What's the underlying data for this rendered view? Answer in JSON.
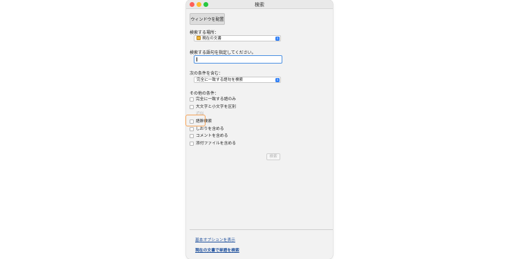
{
  "window": {
    "title": "検索"
  },
  "toolbar": {
    "arrange_label": "ウィンドウを配置"
  },
  "location": {
    "label": "検索する場所：",
    "value": "現在の文書"
  },
  "query": {
    "label": "検索する語句を指定してください。",
    "value": ""
  },
  "condition": {
    "label": "次の条件を含む：",
    "value": "完全に一致する語句を検索"
  },
  "options": {
    "label": "その他の条件：",
    "items": [
      {
        "label": "完全に一致する語のみ",
        "checked": false,
        "enabled": true
      },
      {
        "label": "大文字と小文字を区別",
        "checked": false,
        "enabled": true
      },
      {
        "label": "近似",
        "checked": false,
        "enabled": false
      },
      {
        "label": "語幹検索",
        "checked": false,
        "enabled": true
      },
      {
        "label": "しおりを含める",
        "checked": false,
        "enabled": true
      },
      {
        "label": "コメントを含める",
        "checked": false,
        "enabled": true
      },
      {
        "label": "添付ファイルを含める",
        "checked": false,
        "enabled": true
      }
    ]
  },
  "search_button": {
    "label": "検索"
  },
  "links": {
    "basic_options": "基本オプションを表示",
    "find_in_document": "現在の文書で単語を検索"
  },
  "colors": {
    "highlight": "#f5a256",
    "link": "#1d4f9c",
    "focus": "#4a90e2"
  }
}
